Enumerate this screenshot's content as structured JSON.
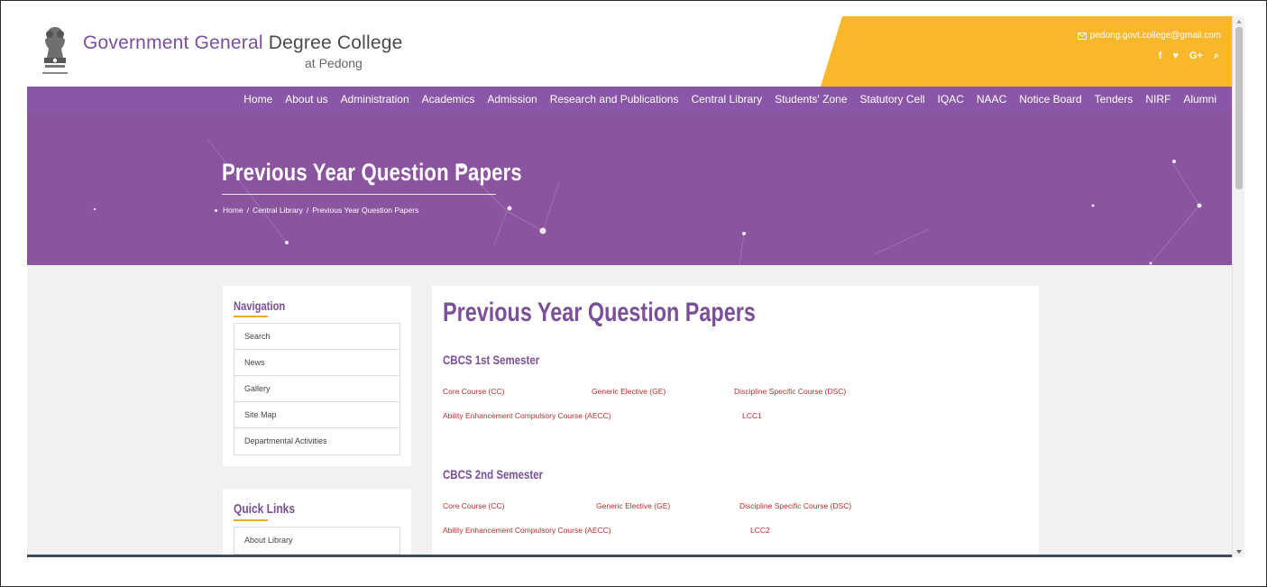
{
  "header": {
    "college_name_part1": "Government General",
    "college_name_part2": "Degree College",
    "college_subtitle": "at Pedong",
    "email": "pedong.govt.college@gmail.com",
    "socials": [
      "f",
      "♥",
      "G+",
      "⌕"
    ],
    "accent_color": "#f9b72c"
  },
  "nav": {
    "items": [
      "Home",
      "About us",
      "Administration",
      "Academics",
      "Admission",
      "Research and Publications",
      "Central Library",
      "Students' Zone",
      "Statutory Cell",
      "IQAC",
      "NAAC",
      "Notice Board",
      "Tenders",
      "NIRF",
      "Alumni"
    ],
    "color": "#8a57a8"
  },
  "hero": {
    "title": "Previous Year Question Papers",
    "breadcrumb": [
      "Home",
      "/",
      "Central Library",
      "/",
      "Previous Year Question Papers"
    ]
  },
  "sidebar": {
    "navigation_title": "Navigation",
    "navigation_items": [
      "Search",
      "News",
      "Gallery",
      "Site Map",
      "Departmental Activities"
    ],
    "quick_links_title": "Quick Links",
    "quick_links_items": [
      "About Library"
    ]
  },
  "main": {
    "title": "Previous Year Question Papers",
    "sem1": {
      "title": "CBCS 1st Semester",
      "links": [
        "Core Course (CC)",
        "Generic Elective (GE)",
        "Discipline Specific Course (DSC)",
        "Ability Enhancement Compulsory Course (AECC)",
        "LCC1"
      ]
    },
    "sem2": {
      "title": "CBCS 2nd Semester",
      "links": [
        "Core Course (CC)",
        "Generic Elective (GE)",
        "Discipline Specific Course (DSC)",
        "Ability Enhancement Compulsory Course (AECC)",
        "LCC2"
      ]
    }
  }
}
